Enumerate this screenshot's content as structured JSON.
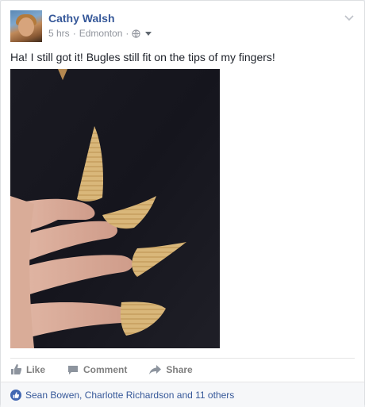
{
  "post": {
    "author": "Cathy Walsh",
    "time": "5 hrs",
    "location": "Edmonton",
    "separator": "·",
    "text": "Ha! I still got it! Bugles still fit on the tips of my fingers!",
    "privacy_icon": "globe-icon",
    "options_icon": "chevron-down-icon"
  },
  "actions": {
    "like": "Like",
    "comment": "Comment",
    "share": "Share"
  },
  "reactions": {
    "summary": "Sean Bowen, Charlotte Richardson and 11 others",
    "icon": "thumbs-up-icon"
  },
  "colors": {
    "link": "#365899",
    "brand": "#4267b2",
    "muted": "#90949c",
    "action": "#7f7f7f"
  }
}
